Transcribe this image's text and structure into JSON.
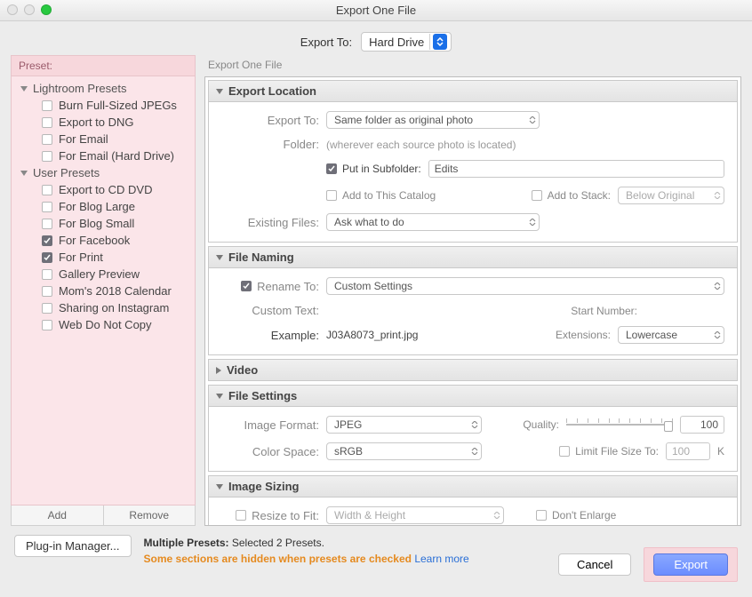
{
  "window": {
    "title": "Export One File"
  },
  "top": {
    "label": "Export To:",
    "value": "Hard Drive"
  },
  "sidebar": {
    "header": "Preset:",
    "groups": [
      {
        "label": "Lightroom Presets",
        "items": [
          {
            "label": "Burn Full-Sized JPEGs",
            "checked": false
          },
          {
            "label": "Export to DNG",
            "checked": false
          },
          {
            "label": "For Email",
            "checked": false
          },
          {
            "label": "For Email (Hard Drive)",
            "checked": false
          }
        ]
      },
      {
        "label": "User Presets",
        "items": [
          {
            "label": "Export to CD DVD",
            "checked": false
          },
          {
            "label": "For Blog Large",
            "checked": false
          },
          {
            "label": "For Blog Small",
            "checked": false
          },
          {
            "label": "For Facebook",
            "checked": true
          },
          {
            "label": "For Print",
            "checked": true
          },
          {
            "label": "Gallery Preview",
            "checked": false
          },
          {
            "label": "Mom's 2018 Calendar",
            "checked": false
          },
          {
            "label": "Sharing on Instagram",
            "checked": false
          },
          {
            "label": "Web Do Not Copy",
            "checked": false
          }
        ]
      }
    ],
    "add": "Add",
    "remove": "Remove"
  },
  "main": {
    "header": "Export One File",
    "location": {
      "title": "Export Location",
      "exportToLabel": "Export To:",
      "exportToValue": "Same folder as original photo",
      "folderLabel": "Folder:",
      "folderNote": "(wherever each source photo is located)",
      "subfolderChk": "Put in Subfolder:",
      "subfolderValue": "Edits",
      "addCatalog": "Add to This Catalog",
      "addStack": "Add to Stack:",
      "stackValue": "Below Original",
      "existingLabel": "Existing Files:",
      "existingValue": "Ask what to do"
    },
    "naming": {
      "title": "File Naming",
      "renameChk": "Rename To:",
      "renameValue": "Custom Settings",
      "customLabel": "Custom Text:",
      "startLabel": "Start Number:",
      "exampleLabel": "Example:",
      "exampleValue": "J03A8073_print.jpg",
      "extLabel": "Extensions:",
      "extValue": "Lowercase"
    },
    "video": {
      "title": "Video"
    },
    "filesettings": {
      "title": "File Settings",
      "formatLabel": "Image Format:",
      "formatValue": "JPEG",
      "qualityLabel": "Quality:",
      "qualityValue": "100",
      "colorLabel": "Color Space:",
      "colorValue": "sRGB",
      "limitChk": "Limit File Size To:",
      "limitValue": "100",
      "limitUnit": "K"
    },
    "sizing": {
      "title": "Image Sizing",
      "resizeChk": "Resize to Fit:",
      "resizeValue": "Width & Height",
      "enlargeChk": "Don't Enlarge"
    }
  },
  "footer": {
    "plugin": "Plug-in Manager...",
    "multiLabel": "Multiple Presets: ",
    "multiValue": "Selected 2 Presets.",
    "warn": "Some sections are hidden when presets are checked",
    "learn": "Learn more",
    "cancel": "Cancel",
    "export": "Export"
  }
}
